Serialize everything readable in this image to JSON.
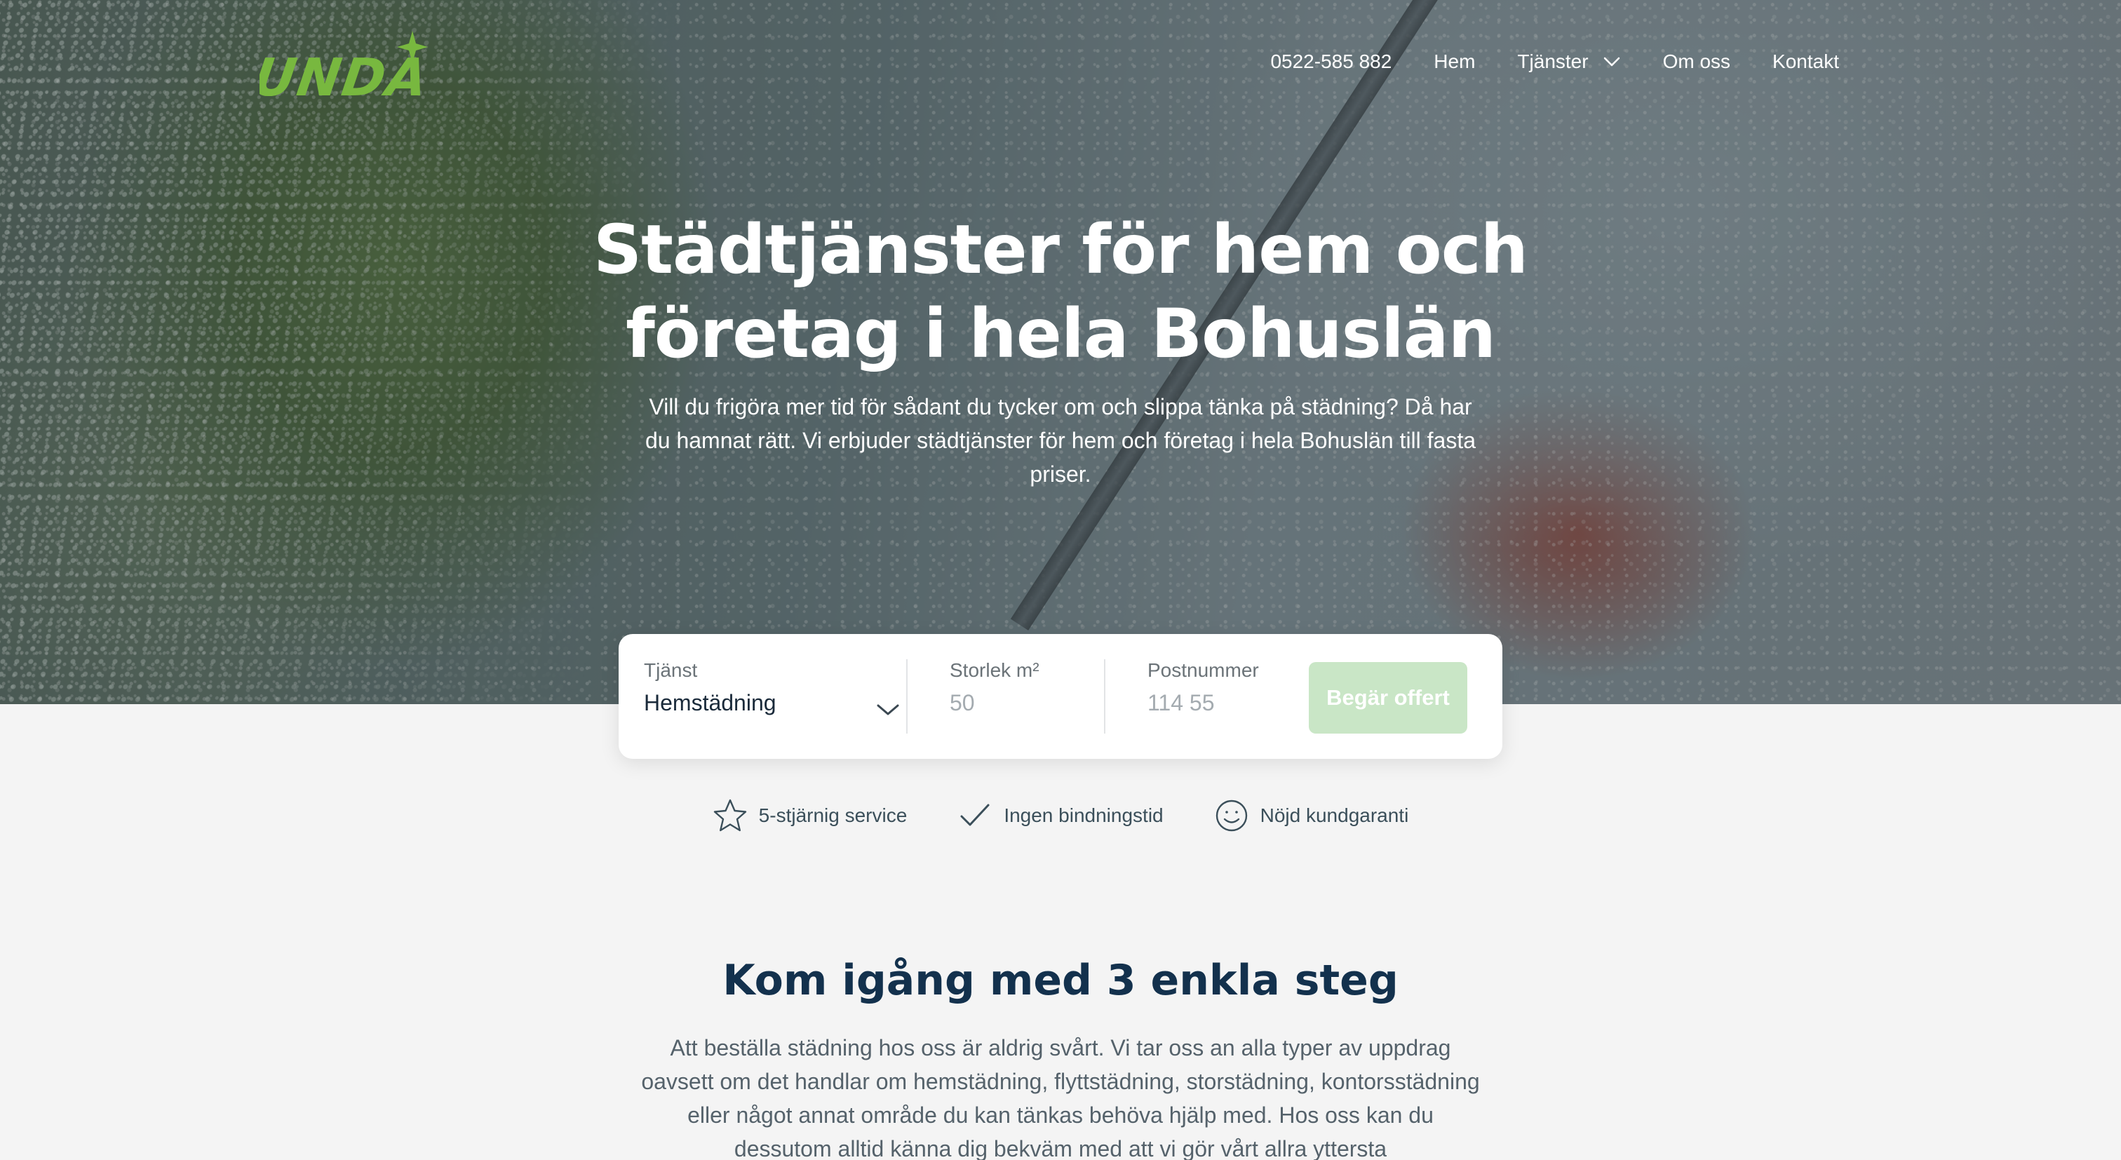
{
  "nav": {
    "logo_text": "UNDA",
    "phone": "0522-585 882",
    "items": [
      {
        "label": "Hem"
      },
      {
        "label": "Tjänster",
        "icon": "chevron-down-icon"
      },
      {
        "label": "Om oss"
      },
      {
        "label": "Kontakt"
      }
    ]
  },
  "hero": {
    "title": "Städtjänster för hem och företag i hela Bohuslän",
    "subtitle": "Vill du frigöra mer tid för sådant du tycker om och slippa tänka på städning? Då har du hamnat rätt. Vi erbjuder städtjänster för hem och företag i hela Bohuslän till fasta priser."
  },
  "offer_form": {
    "service_label": "Tjänst",
    "service_value": "Hemstädning",
    "size_label": "Storlek m²",
    "size_placeholder": "50",
    "zip_label": "Postnummer",
    "zip_placeholder": "114 55",
    "submit_label": "Begär offert"
  },
  "features": [
    {
      "icon": "star-icon",
      "label": "5-stjärnig service"
    },
    {
      "icon": "check-icon",
      "label": "Ingen bindningstid"
    },
    {
      "icon": "smiley-icon",
      "label": "Nöjd kundgaranti"
    }
  ],
  "steps": {
    "title": "Kom igång med 3 enkla steg",
    "text": "Att beställa städning hos oss är aldrig svårt. Vi tar oss an alla typer av uppdrag oavsett om det handlar om hemstädning, flyttstädning, storstädning, kontorsstädning eller något annat område du kan tänkas behöva hjälp med. Hos oss kan du dessutom alltid känna dig bekväm med att vi gör vårt allra yttersta"
  },
  "colors": {
    "brand_green": "#78b83f",
    "heading_navy": "#13314d",
    "button_disabled": "#c9e6c6",
    "page_bg": "#f4f4f4"
  }
}
